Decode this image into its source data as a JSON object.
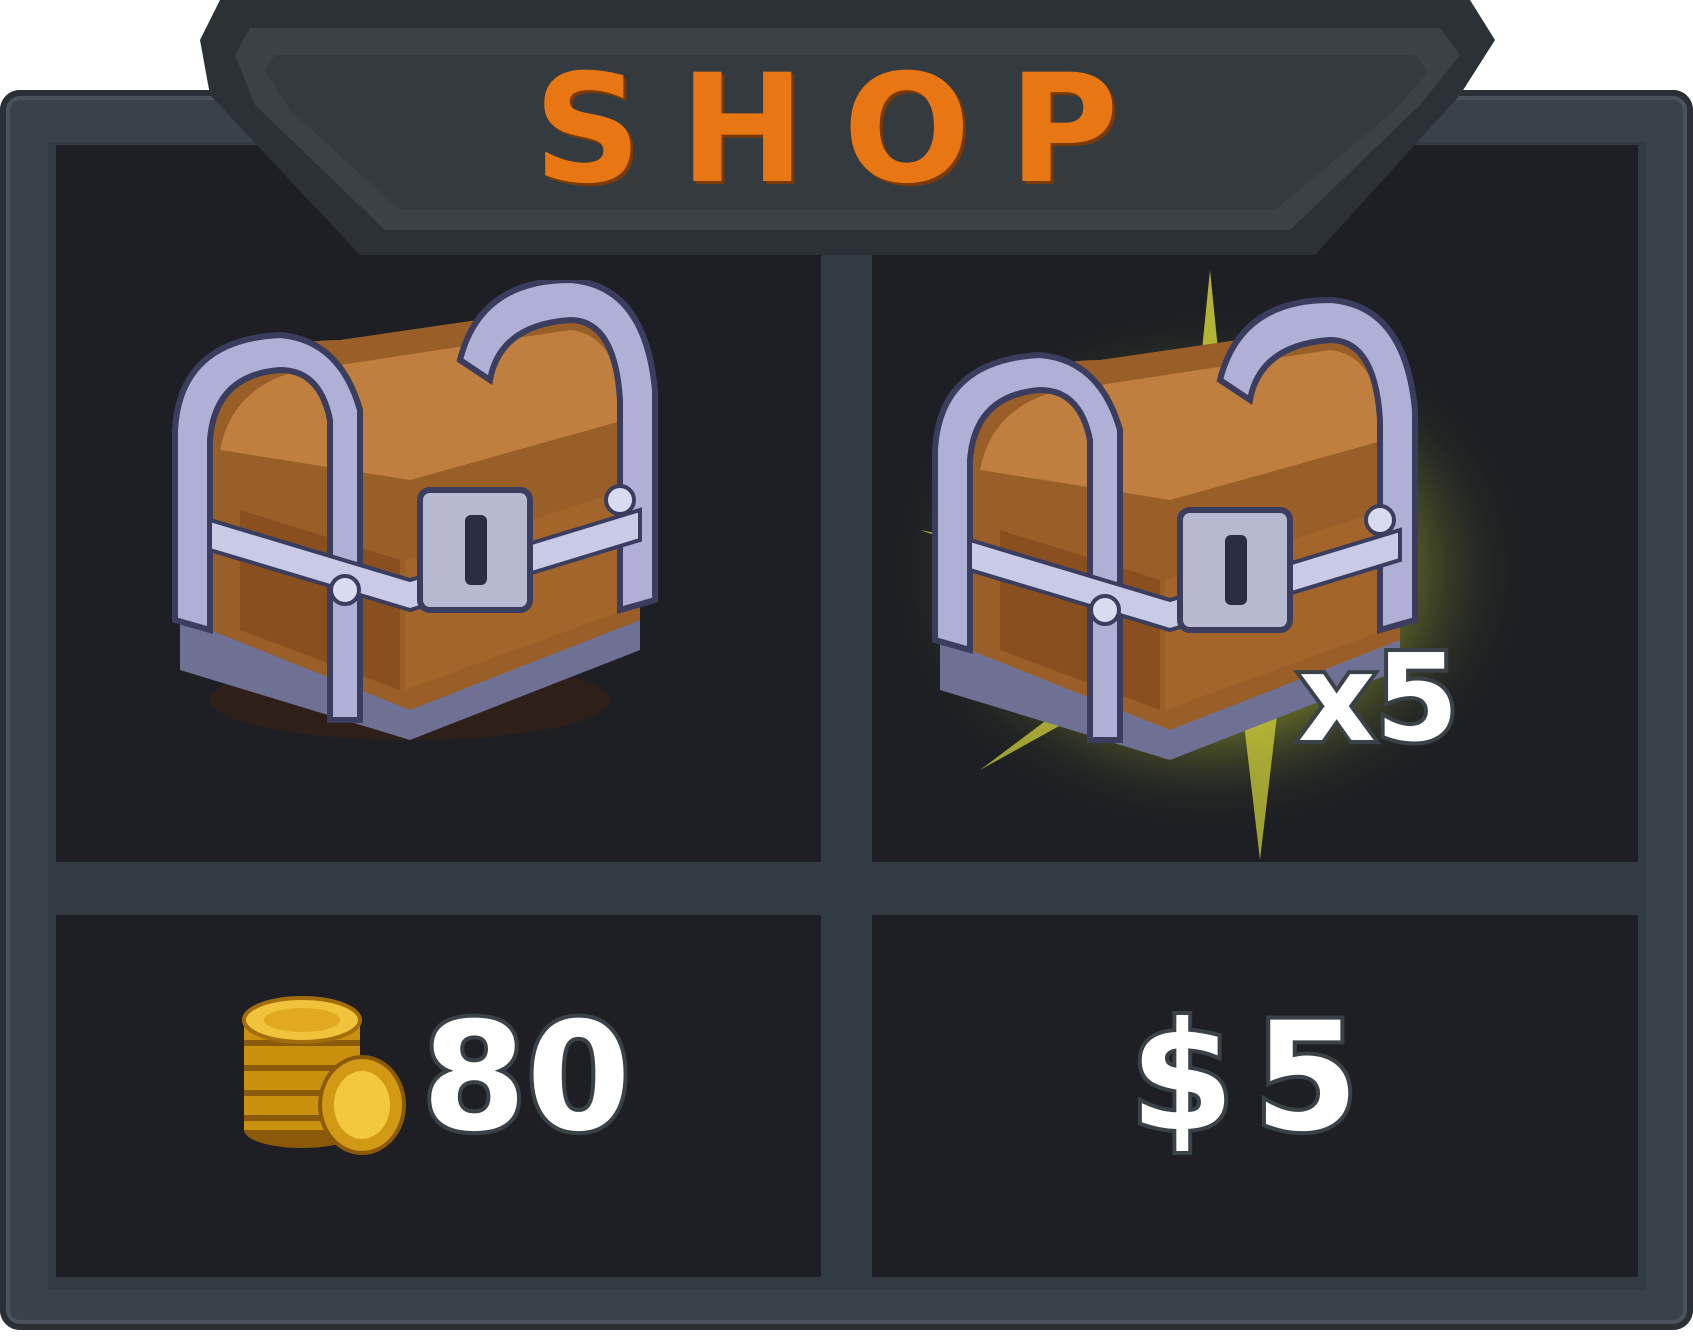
{
  "shop": {
    "title": "SHOP"
  },
  "items": [
    {
      "icon": "treasure-chest-icon",
      "price": "80",
      "currency_icon": "gold-coin-stack-icon"
    },
    {
      "icon": "treasure-chest-glow-icon",
      "quantity": "x5",
      "price": "$5"
    }
  ],
  "colors": {
    "title": "#e87612",
    "frame": "#3a4249",
    "panel": "#1d1f24",
    "price_text": "#ffffff",
    "glow": "#c8d23a"
  }
}
